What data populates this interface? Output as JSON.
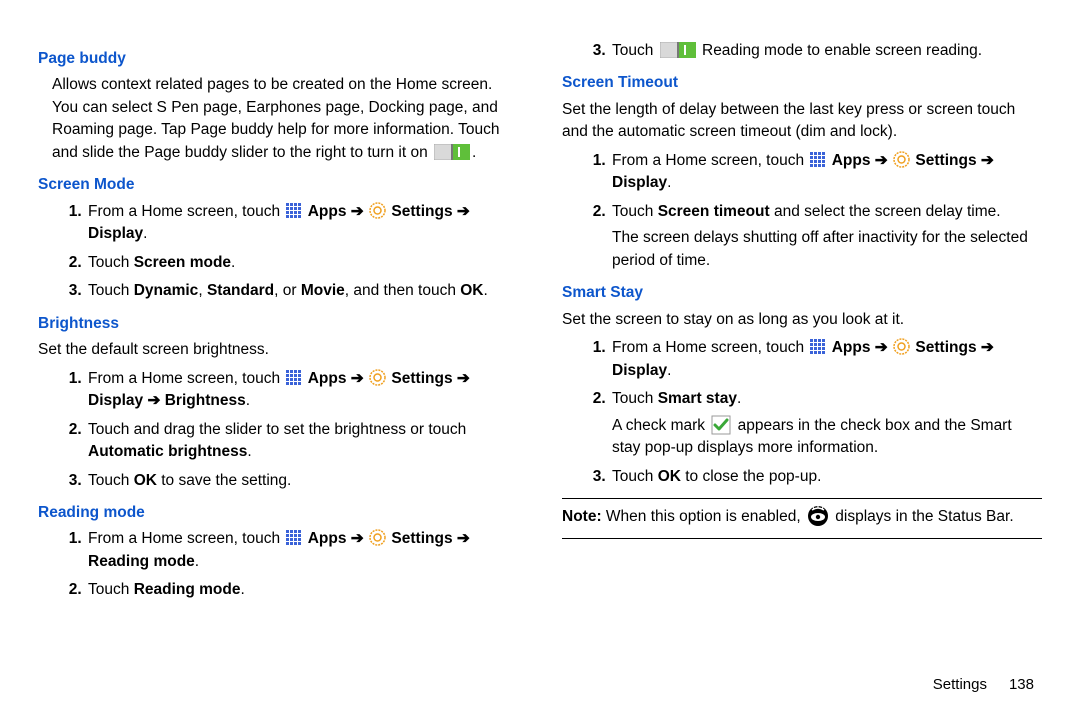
{
  "left": {
    "pageBuddy": {
      "heading": "Page buddy",
      "para": "Allows context related pages to be created on the Home screen. You can select S Pen page, Earphones page, Docking page, and Roaming page. Tap Page buddy help for more information. Touch and slide the Page buddy slider to the right to turn it on",
      "paraEnd": "."
    },
    "screenMode": {
      "heading": "Screen Mode",
      "step1_pre": "From a Home screen, touch",
      "step1_apps": "Apps",
      "step1_arrow": "➔",
      "step1_settings": "Settings",
      "step1_b2": "➔ Display",
      "step1_end": ".",
      "step2_pre": "Touch",
      "step2_bold": "Screen mode",
      "step2_end": ".",
      "step3_pre": "Touch",
      "step3_b1": "Dynamic",
      "step3_c1": ", ",
      "step3_b2": "Standard",
      "step3_c2": ", or ",
      "step3_b3": "Movie",
      "step3_c3": ", and then touch ",
      "step3_b4": "OK",
      "step3_end": "."
    },
    "brightness": {
      "heading": "Brightness",
      "para": "Set the default screen brightness.",
      "step1_pre": "From a Home screen, touch",
      "step1_apps": "Apps",
      "step1_arrow": "➔",
      "step1_settings": "Settings",
      "step1_b2": "➔ Display ➔ Brightness",
      "step1_end": ".",
      "step2_pre": "Touch and drag the slider to set the brightness or touch",
      "step2_bold": "Automatic brightness",
      "step2_end": ".",
      "step3_pre": "Touch",
      "step3_bold": "OK",
      "step3_end": " to save the setting."
    },
    "readingMode": {
      "heading": "Reading mode",
      "step1_pre": "From a Home screen, touch",
      "step1_apps": "Apps",
      "step1_arrow": "➔",
      "step1_settings": "Settings",
      "step1_b2": "➔ Reading mode",
      "step1_end": ".",
      "step2_pre": "Touch",
      "step2_bold": "Reading mode",
      "step2_end": "."
    }
  },
  "right": {
    "readingCont": {
      "step3_pre": "Touch",
      "step3_mid": " Reading mode to enable screen reading."
    },
    "screenTimeout": {
      "heading": "Screen Timeout",
      "para": "Set the length of delay between the last key press or screen touch and the automatic screen timeout (dim and lock).",
      "step1_pre": "From a Home screen, touch",
      "step1_apps": "Apps",
      "step1_arrow": "➔",
      "step1_settings": "Settings",
      "step1_b2": "➔ Display",
      "step1_end": ".",
      "step2_pre": "Touch",
      "step2_bold": "Screen timeout",
      "step2_end": " and select the screen delay time.",
      "step2_p2": "The screen delays shutting off after inactivity for the selected period of time."
    },
    "smartStay": {
      "heading": "Smart Stay",
      "para": "Set the screen to stay on as long as you look at it.",
      "step1_pre": "From a Home screen, touch",
      "step1_apps": "Apps",
      "step1_arrow": "➔",
      "step1_settings": "Settings",
      "step1_b2": "➔ Display",
      "step1_end": ".",
      "step2_pre": "Touch",
      "step2_bold": "Smart stay",
      "step2_end": ".",
      "step2_p2a": "A check mark",
      "step2_p2b": " appears in the check box and the Smart stay pop-up displays more information.",
      "step3_pre": "Touch",
      "step3_bold": "OK",
      "step3_end": " to close the pop-up.",
      "note_label": "Note:",
      "note_a": " When this option is enabled,",
      "note_b": " displays in the Status Bar."
    }
  },
  "footer": {
    "section": "Settings",
    "page": "138"
  }
}
